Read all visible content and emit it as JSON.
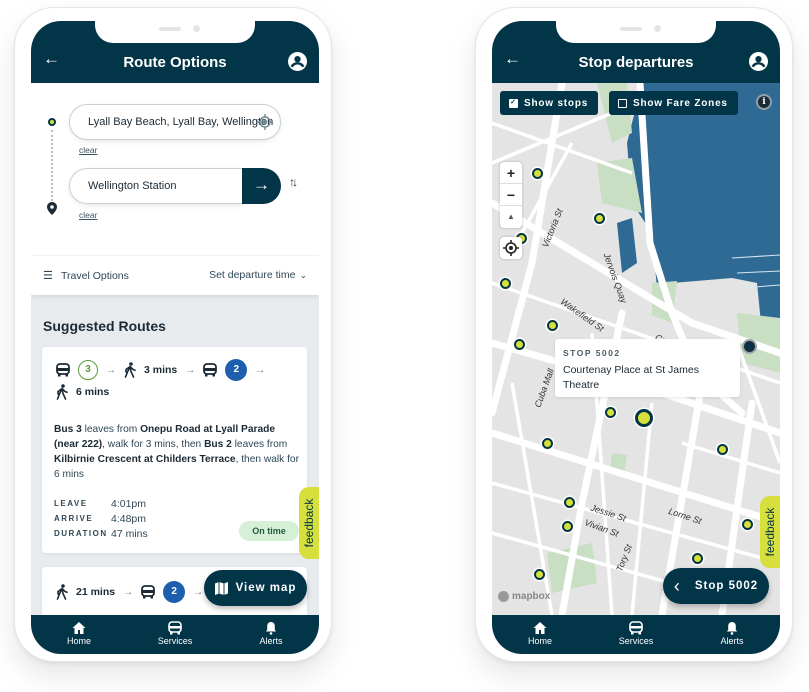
{
  "common": {
    "nav": [
      {
        "label": "Home",
        "icon": "home-icon"
      },
      {
        "label": "Services",
        "icon": "bus-icon"
      },
      {
        "label": "Alerts",
        "icon": "bell-icon"
      }
    ],
    "feedback_label": "feedback",
    "colors": {
      "brand": "#023548",
      "accent": "#d6df3b",
      "route_blue": "#1d5fae",
      "route_green": "#5a9a3a",
      "on_time_bg": "#d6f0d8"
    }
  },
  "route_options": {
    "header": {
      "title": "Route Options",
      "back_icon": "arrow-left-icon",
      "account_icon": "account-circle-icon"
    },
    "search": {
      "origin_value": "Lyall Bay Beach, Lyall Bay, Wellington",
      "destination_value": "Wellington Station",
      "clear_label": "clear",
      "swap_label": "⇅"
    },
    "options": {
      "travel_options": "Travel Options",
      "departure": "Set departure time"
    },
    "suggested_heading": "Suggested Routes",
    "routes": [
      {
        "legs": [
          {
            "type": "bus",
            "route": "3",
            "style": "outline"
          },
          {
            "type": "walk",
            "duration": "3 mins"
          },
          {
            "type": "bus",
            "route": "2",
            "style": "filled"
          },
          {
            "type": "walk",
            "duration": "6 mins"
          }
        ],
        "description": {
          "bus1": "Bus 3",
          "t1": " leaves from ",
          "stop1": "Onepu Road at Lyall Parade (near 222)",
          "t2": ", walk for 3 mins, then ",
          "bus2": "Bus 2",
          "t3": " leaves from ",
          "stop2": "Kilbirnie Crescent at Childers Terrace",
          "t4": ", then walk for 6 mins"
        },
        "leave_label": "LEAVE",
        "leave": "4:01pm",
        "arrive_label": "ARRIVE",
        "arrive": "4:48pm",
        "duration_label": "DURATION",
        "duration": "47 mins",
        "status": "On time"
      },
      {
        "legs": [
          {
            "type": "walk",
            "duration": "21 mins"
          },
          {
            "type": "bus",
            "route": "2",
            "style": "filled"
          }
        ]
      }
    ],
    "view_map_label": "View map"
  },
  "stop_departures": {
    "header": {
      "title": "Stop departures"
    },
    "toggles": {
      "show_stops": "Show stops",
      "show_stops_checked": true,
      "show_fare_zones": "Show Fare Zones",
      "show_fare_zones_checked": false
    },
    "info_label": "i",
    "zoom": {
      "in": "+",
      "out": "−",
      "compass": "▲"
    },
    "streets": [
      "Victoria St",
      "Jervois Quay",
      "Wakefield St",
      "Cable St",
      "Cuba Mall",
      "Jessie St",
      "Lorne St",
      "Vivian St",
      "Tory St"
    ],
    "popup": {
      "code": "STOP 5002",
      "name": "Courtenay Place at St James Theatre"
    },
    "attribution": "mapbox",
    "stop_button": "Stop 5002"
  }
}
